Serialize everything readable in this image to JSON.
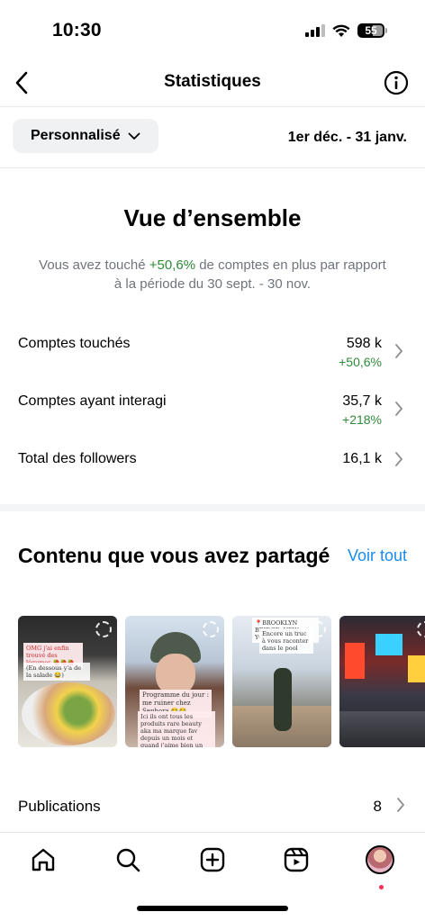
{
  "status_bar": {
    "time": "10:30",
    "battery": "55"
  },
  "header": {
    "title": "Statistiques",
    "back_icon": "chevron-left-icon",
    "info_icon": "info-icon"
  },
  "filter": {
    "range_label": "Personnalisé",
    "date_range": "1er déc. - 31 janv."
  },
  "overview": {
    "title": "Vue d’ensemble",
    "desc_before": "Vous avez touché ",
    "desc_pct": "+50,6%",
    "desc_after": " de comptes en plus par rapport à la période du 30 sept. - 30 nov.",
    "stats": [
      {
        "label": "Comptes touchés",
        "value": "598 k",
        "change": "+50,6%"
      },
      {
        "label": "Comptes ayant interagi",
        "value": "35,7 k",
        "change": "+218%"
      },
      {
        "label": "Total des followers",
        "value": "16,1 k",
        "change": ""
      }
    ]
  },
  "content": {
    "title": "Contenu que vous avez partagé",
    "see_all": "Voir tout",
    "thumbnails": [
      {
        "caption": "OMG j'ai enfin trouvé des légumes 🍓🍓🍓",
        "caption2": "(En dessous y'a de la salade 😂)"
      },
      {
        "caption": "Programme du jour : me ruiner chez Sephora 😂😂",
        "caption2": "Ici ils ont tous les produits rare beauty aka ma marque fav depuis un mois et quand j'aime bien un truc je fais une obsession (comme mon copain 😂)"
      },
      {
        "caption": "📍BROOKLYN BRIDGE, NEW YORK",
        "caption2": "Encore un truc à vous raconter dans le pool"
      },
      {
        "caption": "",
        "caption2": ""
      }
    ]
  },
  "publications": {
    "label": "Publications",
    "value": "8"
  },
  "tab_bar": {
    "items": [
      "home-icon",
      "search-icon",
      "create-icon",
      "reels-icon",
      "profile-avatar"
    ]
  },
  "colors": {
    "positive": "#2e8b3a",
    "link": "#1a8cf0",
    "muted": "#70757b"
  }
}
